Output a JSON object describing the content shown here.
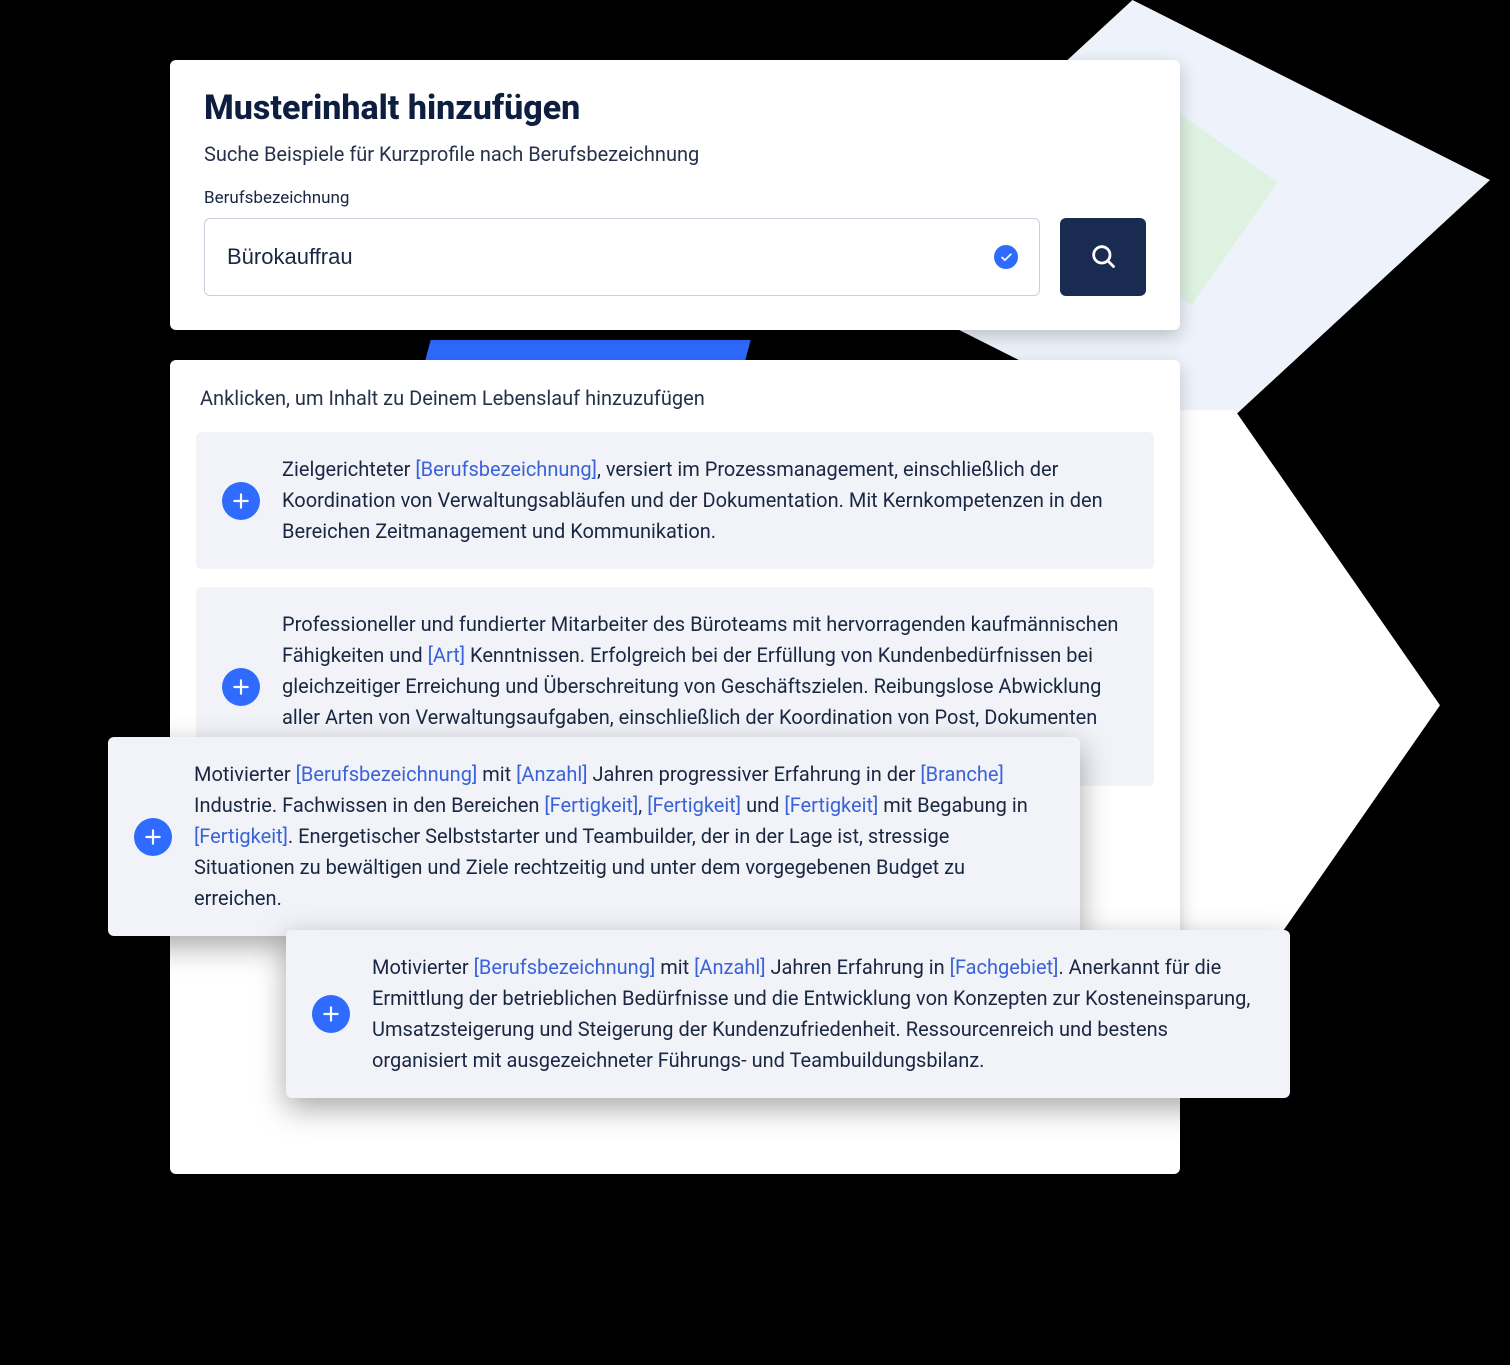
{
  "header": {
    "title": "Musterinhalt hinzufügen",
    "subtitle": "Suche Beispiele für Kurzprofile nach Berufsbezeichnung",
    "field_label": "Berufsbezeichnung",
    "field_value": "Bürokauffrau"
  },
  "results": {
    "instruction": "Anklicken, um Inhalt zu Deinem Lebenslauf hinzuzufügen",
    "items": [
      {
        "segments": [
          {
            "t": "Zielgerichteter "
          },
          {
            "t": "[Berufsbezeichnung]",
            "token": true
          },
          {
            "t": ", versiert im Prozessmanagement, einschließlich der Koordination von Verwaltungsabläufen und der Dokumentation. Mit Kernkompetenzen in den Bereichen Zeitmanagement und Kommunikation."
          }
        ]
      },
      {
        "segments": [
          {
            "t": "Professioneller und fundierter Mitarbeiter des Büroteams mit hervorragenden kaufmännischen Fähigkeiten und "
          },
          {
            "t": "[Art]",
            "token": true
          },
          {
            "t": " Kenntnissen. Erfolgreich bei der Erfüllung von Kundenbedürfnissen bei gleichzeitiger Erreichung und Überschreitung von Geschäftszielen. Reibungslose Abwicklung aller Arten von Verwaltungsaufgaben, einschließlich der Koordination von Post, Dokumenten und Reisearrangements."
          }
        ]
      },
      {
        "segments": [
          {
            "t": "Motivierter "
          },
          {
            "t": "[Berufsbezeichnung]",
            "token": true
          },
          {
            "t": " mit "
          },
          {
            "t": "[Anzahl]",
            "token": true
          },
          {
            "t": " Jahren progressiver Erfahrung in der "
          },
          {
            "t": "[Branche]",
            "token": true
          },
          {
            "t": " Industrie. Fachwissen in den Bereichen "
          },
          {
            "t": "[Fertigkeit]",
            "token": true
          },
          {
            "t": ", "
          },
          {
            "t": "[Fertigkeit]",
            "token": true
          },
          {
            "t": " und "
          },
          {
            "t": "[Fertigkeit]",
            "token": true
          },
          {
            "t": " mit Begabung in "
          },
          {
            "t": "[Fertigkeit]",
            "token": true
          },
          {
            "t": ". Energetischer Selbststarter und Teambuilder, der in der Lage ist, stressige Situationen zu bewältigen und Ziele rechtzeitig und unter dem vorgegebenen Budget zu erreichen."
          }
        ]
      },
      {
        "segments": [
          {
            "t": "Motivierter "
          },
          {
            "t": "[Berufsbezeichnung]",
            "token": true
          },
          {
            "t": " mit "
          },
          {
            "t": "[Anzahl]",
            "token": true
          },
          {
            "t": " Jahren Erfahrung in "
          },
          {
            "t": "[Fachgebiet]",
            "token": true
          },
          {
            "t": ". Anerkannt für die Ermittlung der betrieblichen Bedürfnisse und die Entwicklung von Konzepten zur Kosteneinsparung, Umsatzsteigerung und Steigerung der Kundenzufriedenheit. Ressourcenreich und bestens organisiert mit ausgezeichneter Führungs- und Teambuildungsbilanz."
          }
        ]
      }
    ]
  }
}
